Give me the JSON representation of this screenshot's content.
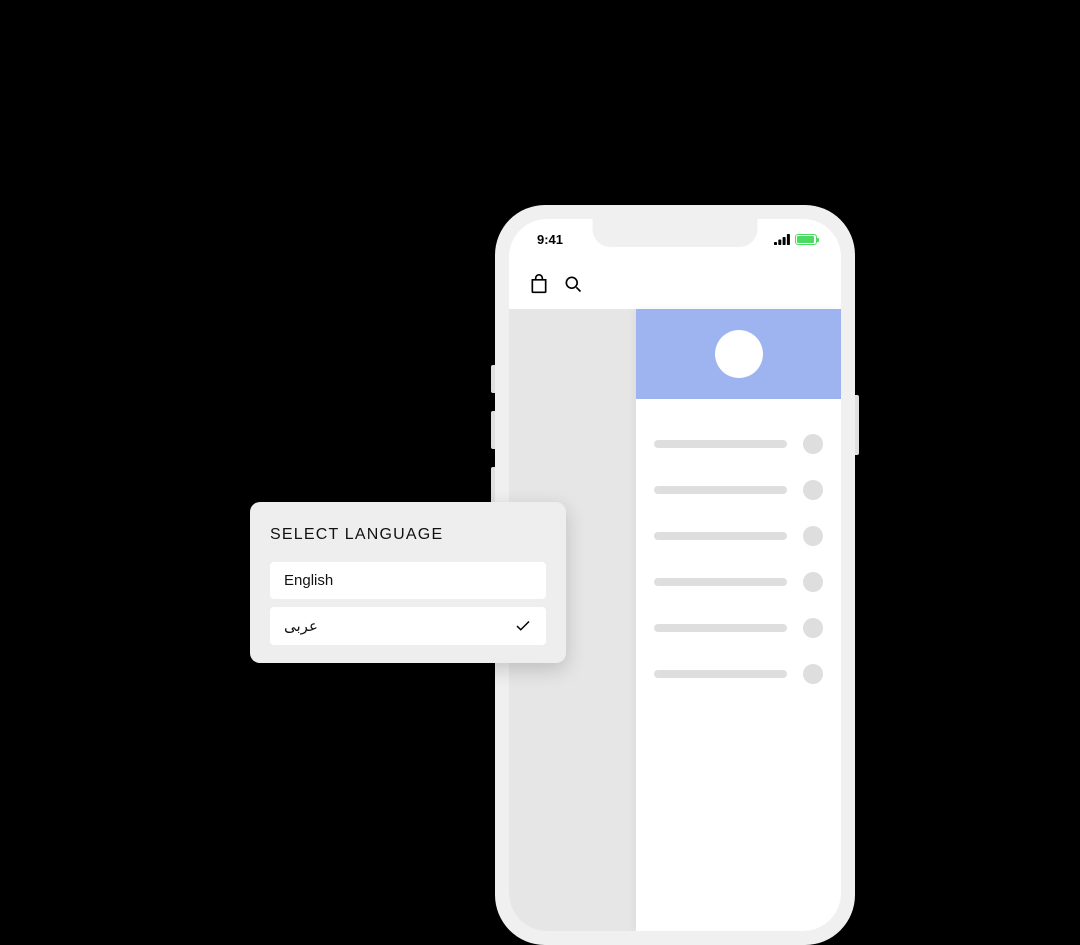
{
  "status": {
    "time": "9:41"
  },
  "language": {
    "title": "SELECT LANGUAGE",
    "options": [
      {
        "label": "English",
        "selected": false
      },
      {
        "label": "عربى",
        "selected": true
      }
    ]
  },
  "drawer": {
    "item_count": 6
  },
  "colors": {
    "accent": "#9db4f0",
    "battery": "#4cd964"
  }
}
